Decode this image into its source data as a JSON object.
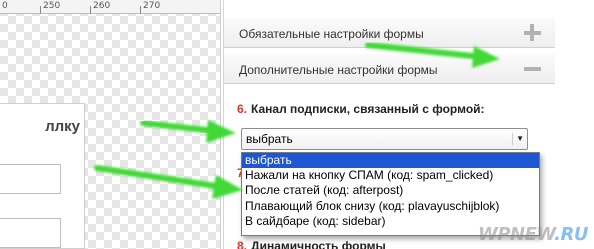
{
  "ruler": {
    "labels": [
      "0",
      "250",
      "260",
      "270"
    ]
  },
  "preview": {
    "title_fragment": "ллку"
  },
  "panel": {
    "sections": [
      {
        "label": "Обязательные настройки формы",
        "toggle_icon": "plus-icon",
        "expanded": false
      },
      {
        "label": "Дополнительные настройки формы",
        "toggle_icon": "minus-icon",
        "expanded": true
      }
    ],
    "field_number": "6.",
    "field_label": "Канал подписки, связанный с формой:",
    "select_value": "выбрать",
    "dropdown_options": [
      "выбрать",
      "Нажали на кнопку СПАМ (код: spam_clicked)",
      "После статей (код: afterpost)",
      "Плавающий блок снизу (код: plavayuschijblok)",
      "В сайдбаре (код: sidebar)"
    ],
    "hidden_field_number": "7",
    "next_field_number": "8.",
    "next_field_label": "Динамичность формы"
  },
  "watermark": {
    "text_main": "WPNEW",
    "text_accent": ".RU"
  },
  "colors": {
    "arrow": "#3fd935",
    "highlight": "#1e56d4",
    "number": "#d9382a"
  }
}
